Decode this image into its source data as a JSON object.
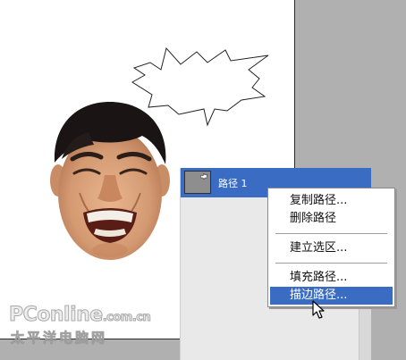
{
  "paths_panel": {
    "rows": [
      {
        "name": "路径 1",
        "selected": true
      }
    ],
    "colors": {
      "selection": "#3b6cc3",
      "panel_bg": "#e9e9e9"
    }
  },
  "context_menu": {
    "items": [
      {
        "label": "复制路径...",
        "highlighted": false
      },
      {
        "label": "删除路径",
        "highlighted": false
      },
      {
        "label": "建立选区...",
        "highlighted": false
      },
      {
        "label": "填充路径...",
        "highlighted": false
      },
      {
        "label": "描边路径...",
        "highlighted": true
      }
    ]
  },
  "canvas": {
    "objects": [
      "speech-bubble-path",
      "laughing-face-photo"
    ]
  },
  "watermark": {
    "brand": "PConline",
    "domain": ".com.cn",
    "tagline": "太平洋电脑网"
  }
}
